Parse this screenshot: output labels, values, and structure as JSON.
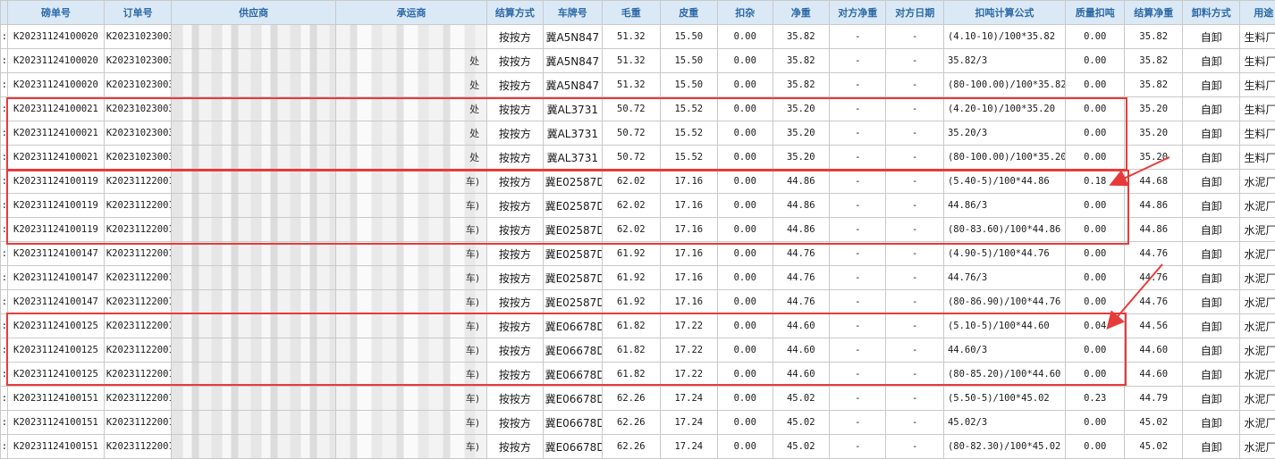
{
  "columns": [
    "",
    "磅单号",
    "订单号",
    "供应商",
    "承运商",
    "结算方式",
    "车牌号",
    "毛重",
    "皮重",
    "扣杂",
    "净重",
    "对方净重",
    "对方日期",
    "扣吨计算公式",
    "质量扣吨",
    "结算净重",
    "卸料方式",
    "用途"
  ],
  "rows": [
    {
      "mark": ":",
      "ticket": "K20231124100020",
      "order": "K20231023003",
      "carrier_tail": "",
      "settle": "按按方",
      "plate": "冀A5N847",
      "gross": "51.32",
      "tare": "15.50",
      "deduct": "0.00",
      "net": "35.82",
      "peer_net": "-",
      "peer_date": "-",
      "formula": "(4.10-10)/100*35.82",
      "quality": "0.00",
      "settle_net": "35.82",
      "unload": "自卸",
      "usage": "生料厂"
    },
    {
      "mark": ":",
      "ticket": "K20231124100020",
      "order": "K20231023003",
      "carrier_tail": "处",
      "settle": "按按方",
      "plate": "冀A5N847",
      "gross": "51.32",
      "tare": "15.50",
      "deduct": "0.00",
      "net": "35.82",
      "peer_net": "-",
      "peer_date": "-",
      "formula": "35.82/3",
      "quality": "0.00",
      "settle_net": "35.82",
      "unload": "自卸",
      "usage": "生料厂"
    },
    {
      "mark": ":",
      "ticket": "K20231124100020",
      "order": "K20231023003",
      "carrier_tail": "处",
      "settle": "按按方",
      "plate": "冀A5N847",
      "gross": "51.32",
      "tare": "15.50",
      "deduct": "0.00",
      "net": "35.82",
      "peer_net": "-",
      "peer_date": "-",
      "formula": "(80-100.00)/100*35.82",
      "quality": "0.00",
      "settle_net": "35.82",
      "unload": "自卸",
      "usage": "生料厂"
    },
    {
      "mark": ":",
      "ticket": "K20231124100021",
      "order": "K20231023003",
      "carrier_tail": "处",
      "settle": "按按方",
      "plate": "冀AL3731",
      "gross": "50.72",
      "tare": "15.52",
      "deduct": "0.00",
      "net": "35.20",
      "peer_net": "-",
      "peer_date": "-",
      "formula": "(4.20-10)/100*35.20",
      "quality": "0.00",
      "settle_net": "35.20",
      "unload": "自卸",
      "usage": "生料厂"
    },
    {
      "mark": ":",
      "ticket": "K20231124100021",
      "order": "K20231023003",
      "carrier_tail": "处",
      "settle": "按按方",
      "plate": "冀AL3731",
      "gross": "50.72",
      "tare": "15.52",
      "deduct": "0.00",
      "net": "35.20",
      "peer_net": "-",
      "peer_date": "-",
      "formula": "35.20/3",
      "quality": "0.00",
      "settle_net": "35.20",
      "unload": "自卸",
      "usage": "生料厂"
    },
    {
      "mark": ":",
      "ticket": "K20231124100021",
      "order": "K20231023003",
      "carrier_tail": "处",
      "settle": "按按方",
      "plate": "冀AL3731",
      "gross": "50.72",
      "tare": "15.52",
      "deduct": "0.00",
      "net": "35.20",
      "peer_net": "-",
      "peer_date": "-",
      "formula": "(80-100.00)/100*35.20",
      "quality": "0.00",
      "settle_net": "35.20",
      "unload": "自卸",
      "usage": "生料厂"
    },
    {
      "mark": ":",
      "ticket": "K20231124100119",
      "order": "K20231122001",
      "carrier_tail": "车)",
      "settle": "按按方",
      "plate": "冀E02587D",
      "gross": "62.02",
      "tare": "17.16",
      "deduct": "0.00",
      "net": "44.86",
      "peer_net": "-",
      "peer_date": "-",
      "formula": "(5.40-5)/100*44.86",
      "quality": "0.18",
      "settle_net": "44.68",
      "unload": "自卸",
      "usage": "水泥厂"
    },
    {
      "mark": ":",
      "ticket": "K20231124100119",
      "order": "K20231122001",
      "carrier_tail": "车)",
      "settle": "按按方",
      "plate": "冀E02587D",
      "gross": "62.02",
      "tare": "17.16",
      "deduct": "0.00",
      "net": "44.86",
      "peer_net": "-",
      "peer_date": "-",
      "formula": "44.86/3",
      "quality": "0.00",
      "settle_net": "44.86",
      "unload": "自卸",
      "usage": "水泥厂"
    },
    {
      "mark": ":",
      "ticket": "K20231124100119",
      "order": "K20231122001",
      "carrier_tail": "车)",
      "settle": "按按方",
      "plate": "冀E02587D",
      "gross": "62.02",
      "tare": "17.16",
      "deduct": "0.00",
      "net": "44.86",
      "peer_net": "-",
      "peer_date": "-",
      "formula": "(80-83.60)/100*44.86",
      "quality": "0.00",
      "settle_net": "44.86",
      "unload": "自卸",
      "usage": "水泥厂"
    },
    {
      "mark": ":",
      "ticket": "K20231124100147",
      "order": "K20231122001",
      "carrier_tail": "车)",
      "settle": "按按方",
      "plate": "冀E02587D",
      "gross": "61.92",
      "tare": "17.16",
      "deduct": "0.00",
      "net": "44.76",
      "peer_net": "-",
      "peer_date": "-",
      "formula": "(4.90-5)/100*44.76",
      "quality": "0.00",
      "settle_net": "44.76",
      "unload": "自卸",
      "usage": "水泥厂"
    },
    {
      "mark": ":",
      "ticket": "K20231124100147",
      "order": "K20231122001",
      "carrier_tail": "车)",
      "settle": "按按方",
      "plate": "冀E02587D",
      "gross": "61.92",
      "tare": "17.16",
      "deduct": "0.00",
      "net": "44.76",
      "peer_net": "-",
      "peer_date": "-",
      "formula": "44.76/3",
      "quality": "0.00",
      "settle_net": "44.76",
      "unload": "自卸",
      "usage": "水泥厂"
    },
    {
      "mark": ":",
      "ticket": "K20231124100147",
      "order": "K20231122001",
      "carrier_tail": "车)",
      "settle": "按按方",
      "plate": "冀E02587D",
      "gross": "61.92",
      "tare": "17.16",
      "deduct": "0.00",
      "net": "44.76",
      "peer_net": "-",
      "peer_date": "-",
      "formula": "(80-86.90)/100*44.76",
      "quality": "0.00",
      "settle_net": "44.76",
      "unload": "自卸",
      "usage": "水泥厂"
    },
    {
      "mark": ":",
      "ticket": "K20231124100125",
      "order": "K20231122001",
      "carrier_tail": "车)",
      "settle": "按按方",
      "plate": "冀E06678D",
      "gross": "61.82",
      "tare": "17.22",
      "deduct": "0.00",
      "net": "44.60",
      "peer_net": "-",
      "peer_date": "-",
      "formula": "(5.10-5)/100*44.60",
      "quality": "0.04",
      "settle_net": "44.56",
      "unload": "自卸",
      "usage": "水泥厂"
    },
    {
      "mark": ":",
      "ticket": "K20231124100125",
      "order": "K20231122001",
      "carrier_tail": "车)",
      "settle": "按按方",
      "plate": "冀E06678D",
      "gross": "61.82",
      "tare": "17.22",
      "deduct": "0.00",
      "net": "44.60",
      "peer_net": "-",
      "peer_date": "-",
      "formula": "44.60/3",
      "quality": "0.00",
      "settle_net": "44.60",
      "unload": "自卸",
      "usage": "水泥厂"
    },
    {
      "mark": ":",
      "ticket": "K20231124100125",
      "order": "K20231122001",
      "carrier_tail": "车)",
      "settle": "按按方",
      "plate": "冀E06678D",
      "gross": "61.82",
      "tare": "17.22",
      "deduct": "0.00",
      "net": "44.60",
      "peer_net": "-",
      "peer_date": "-",
      "formula": "(80-85.20)/100*44.60",
      "quality": "0.00",
      "settle_net": "44.60",
      "unload": "自卸",
      "usage": "水泥厂"
    },
    {
      "mark": ":",
      "ticket": "K20231124100151",
      "order": "K20231122001",
      "carrier_tail": "车)",
      "settle": "按按方",
      "plate": "冀E06678D",
      "gross": "62.26",
      "tare": "17.24",
      "deduct": "0.00",
      "net": "45.02",
      "peer_net": "-",
      "peer_date": "-",
      "formula": "(5.50-5)/100*45.02",
      "quality": "0.23",
      "settle_net": "44.79",
      "unload": "自卸",
      "usage": "水泥厂"
    },
    {
      "mark": ":",
      "ticket": "K20231124100151",
      "order": "K20231122001",
      "carrier_tail": "车)",
      "settle": "按按方",
      "plate": "冀E06678D",
      "gross": "62.26",
      "tare": "17.24",
      "deduct": "0.00",
      "net": "45.02",
      "peer_net": "-",
      "peer_date": "-",
      "formula": "45.02/3",
      "quality": "0.00",
      "settle_net": "45.02",
      "unload": "自卸",
      "usage": "水泥厂"
    },
    {
      "mark": ":",
      "ticket": "K20231124100151",
      "order": "K20231122001",
      "carrier_tail": "车)",
      "settle": "按按方",
      "plate": "冀E06678D",
      "gross": "62.26",
      "tare": "17.24",
      "deduct": "0.00",
      "net": "45.02",
      "peer_net": "-",
      "peer_date": "-",
      "formula": "(80-82.30)/100*45.02",
      "quality": "0.00",
      "settle_net": "45.02",
      "unload": "自卸",
      "usage": "水泥厂"
    }
  ],
  "annotation_color": "#e83a3a"
}
